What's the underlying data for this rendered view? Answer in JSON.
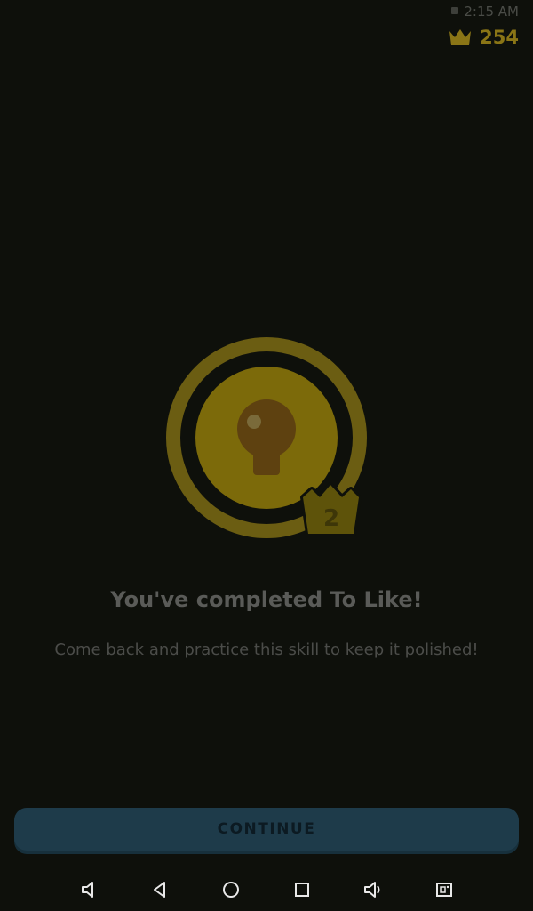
{
  "status_bar": {
    "time": "2:15 AM"
  },
  "header": {
    "crown_count": "254",
    "crown_icon": "crown-icon"
  },
  "badge": {
    "icon": "lightbulb-icon",
    "crown_level": "2"
  },
  "main": {
    "title": "You've completed To Like!",
    "subtitle": "Come back and practice this skill to keep it polished!"
  },
  "footer": {
    "continue_label": "CONTINUE"
  },
  "nav_bar": {
    "items": [
      "volume-down-icon",
      "back-icon",
      "home-icon",
      "recents-icon",
      "volume-up-icon",
      "screenshot-icon"
    ]
  },
  "colors": {
    "background": "#0e100b",
    "gold": "#8a7516",
    "badge_fill": "#7c6a0a",
    "button": "#1e3b4a"
  }
}
